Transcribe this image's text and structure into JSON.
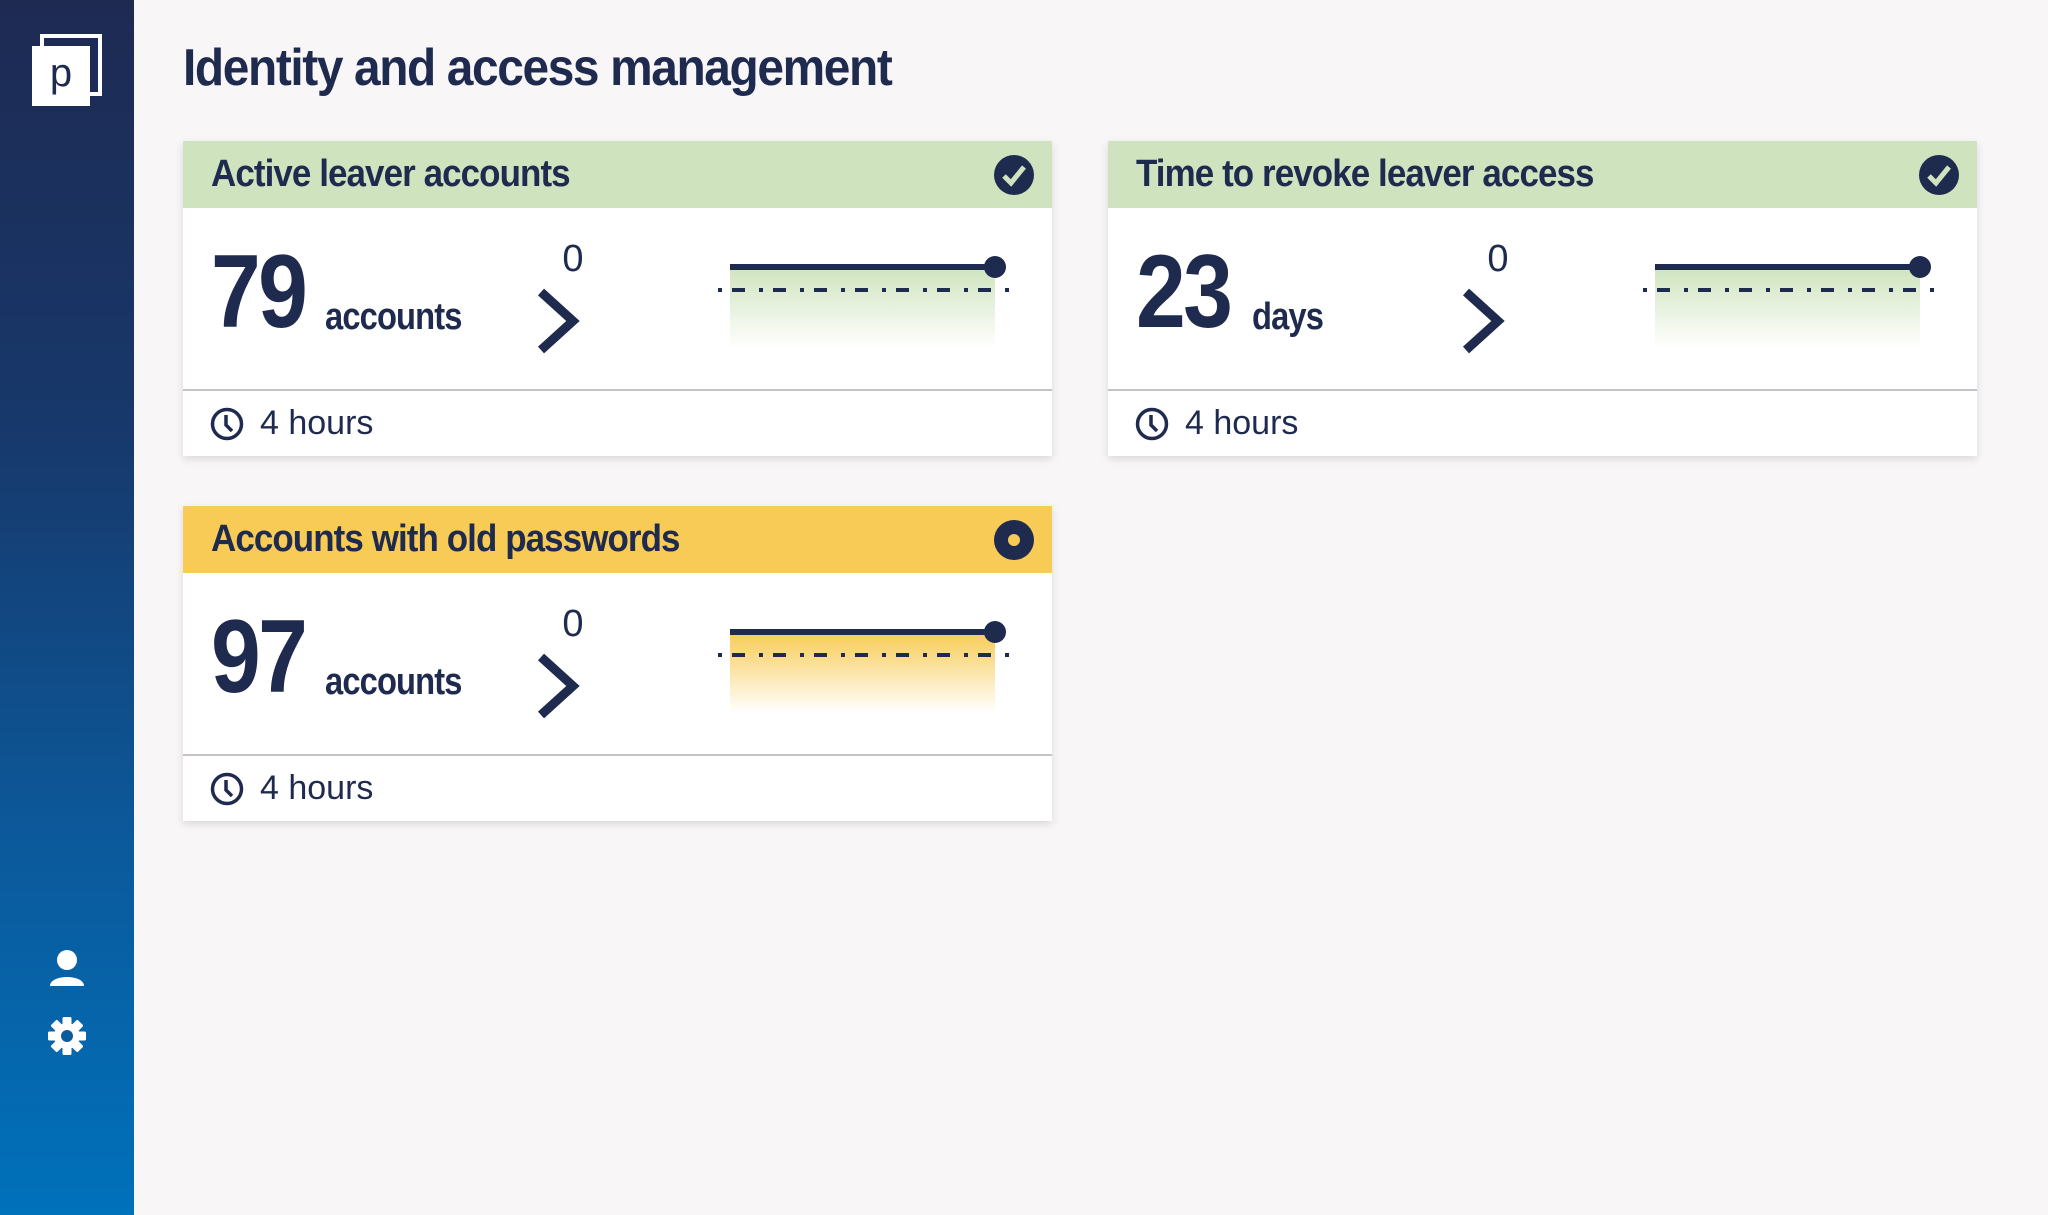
{
  "app": {
    "logo_letter": "p",
    "page_title": "Identity and access management"
  },
  "sidebar": {
    "items": [
      {
        "name": "user-profile",
        "icon": "user-icon"
      },
      {
        "name": "settings",
        "icon": "gear-icon"
      }
    ]
  },
  "colors": {
    "navy": "#1f2a4f",
    "ok_header": "#cfe4be",
    "warn_header": "#f7cb55",
    "ok_fill": "#cfe4be",
    "warn_fill": "#f7cb55"
  },
  "cards": [
    {
      "title": "Active leaver accounts",
      "status": "ok",
      "status_icon": "check-circle-icon",
      "value": "79",
      "unit": "accounts",
      "delta": "0",
      "delta_icon": "chevron-right-icon",
      "updated": "4 hours",
      "trend": {
        "series": [
          79,
          79
        ],
        "target_relative": "below"
      }
    },
    {
      "title": "Time to revoke leaver access",
      "status": "ok",
      "status_icon": "check-circle-icon",
      "value": "23",
      "unit": "days",
      "delta": "0",
      "delta_icon": "chevron-right-icon",
      "updated": "4 hours",
      "trend": {
        "series": [
          23,
          23
        ],
        "target_relative": "below"
      }
    },
    {
      "title": "Accounts with old passwords",
      "status": "warning",
      "status_icon": "ring-icon",
      "value": "97",
      "unit": "accounts",
      "delta": "0",
      "delta_icon": "chevron-right-icon",
      "updated": "4 hours",
      "trend": {
        "series": [
          97,
          97
        ],
        "target_relative": "below"
      }
    }
  ]
}
